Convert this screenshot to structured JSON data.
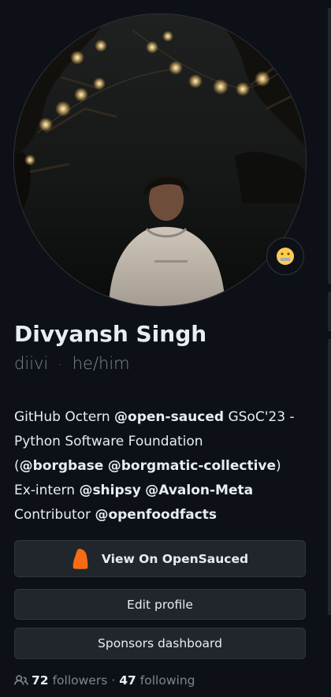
{
  "profile": {
    "name": "Divyansh Singh",
    "login": "diivi",
    "pronouns": "he/him",
    "separator": "·",
    "status_emoji": "zipper-mouth-face"
  },
  "bio": {
    "line1_text": "GitHub Octern ",
    "line1_org": "@open-sauced",
    "line1_tail": " GSoC'23 -",
    "line2_text": "Python Software Foundation",
    "line3_open": "(",
    "line3_org1": "@borgbase",
    "line3_org2": "@borgmatic-collective",
    "line3_close": ")",
    "line4_text": "Ex-intern ",
    "line4_org1": "@shipsy",
    "line4_org2": "@Avalon-Meta",
    "line5_text": "Contributor ",
    "line5_org": "@openfoodfacts"
  },
  "buttons": {
    "opensauced": "View On OpenSauced",
    "edit_profile": "Edit profile",
    "sponsors_dashboard": "Sponsors dashboard"
  },
  "follow": {
    "followers_count": "72",
    "followers_label": "followers",
    "separator": "·",
    "following_count": "47",
    "following_label": "following"
  },
  "colors": {
    "background": "#0d1117",
    "text_primary": "#e6edf3",
    "text_muted": "#7d8590",
    "button_bg": "#21262d",
    "button_border": "#30363d",
    "opensauced_orange": "#f76b15"
  },
  "icons": {
    "people": "people-icon",
    "opensauced_logo": "opensauced-flame-icon",
    "status": "zipper-mouth-emoji-icon"
  }
}
